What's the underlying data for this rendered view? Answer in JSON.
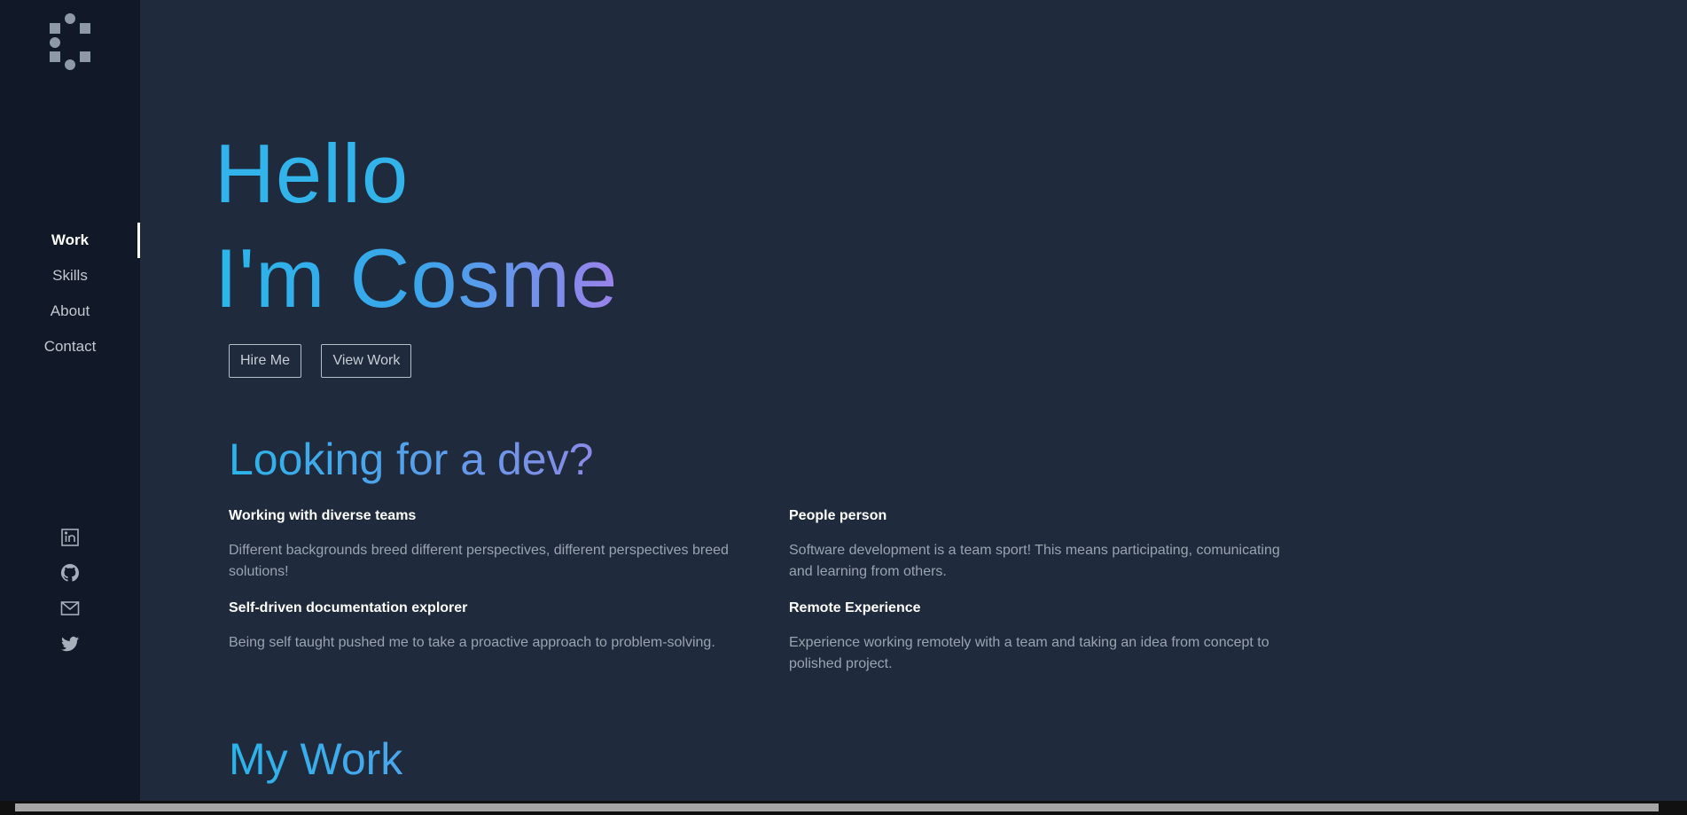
{
  "nav": {
    "items": [
      {
        "label": "Work",
        "active": true
      },
      {
        "label": "Skills",
        "active": false
      },
      {
        "label": "About",
        "active": false
      },
      {
        "label": "Contact",
        "active": false
      }
    ]
  },
  "socials": [
    {
      "icon": "linkedin-icon"
    },
    {
      "icon": "github-icon"
    },
    {
      "icon": "mail-icon"
    },
    {
      "icon": "twitter-icon"
    }
  ],
  "hero": {
    "line1": "Hello",
    "line2": "I'm Cosme",
    "hire_label": "Hire Me",
    "view_label": "View Work"
  },
  "looking": {
    "title": "Looking for a dev?",
    "features": [
      {
        "title": "Working with diverse teams",
        "text": "Different backgrounds breed different perspectives, different perspectives breed solutions!"
      },
      {
        "title": "People person",
        "text": "Software development is a team sport! This means participating, comunicating and learning from others."
      },
      {
        "title": "Self-driven documentation explorer",
        "text": "Being self taught pushed me to take a proactive approach to problem-solving."
      },
      {
        "title": "Remote Experience",
        "text": "Experience working remotely with a team and taking an idea from concept to polished project."
      }
    ]
  },
  "work": {
    "title": "My Work"
  },
  "colors": {
    "background": "#1f2a3d",
    "sidebar": "#111827",
    "accent_start": "#2bb6ea",
    "accent_end": "#9b82ea"
  }
}
